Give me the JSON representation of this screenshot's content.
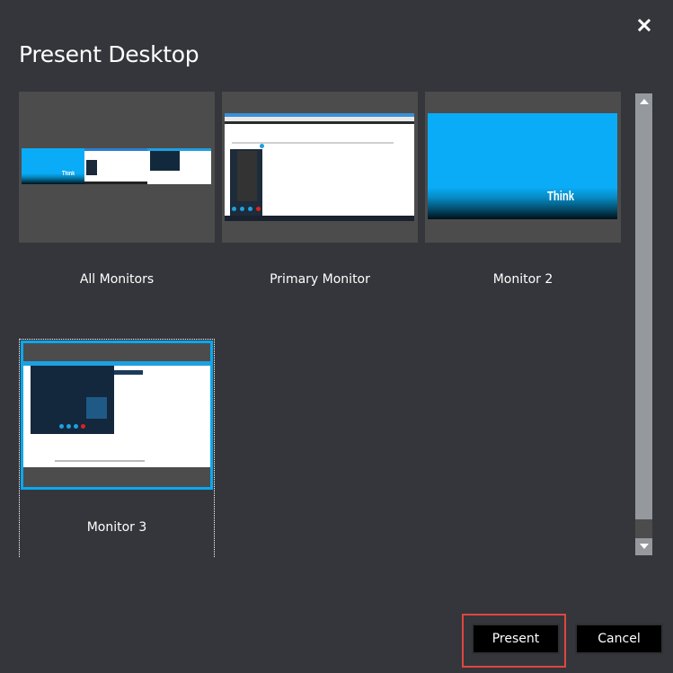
{
  "dialog": {
    "title": "Present Desktop",
    "close_icon": "close-icon"
  },
  "monitors": [
    {
      "label": "All Monitors",
      "selected": false
    },
    {
      "label": "Primary Monitor",
      "selected": false
    },
    {
      "label": "Monitor 2",
      "selected": false,
      "wallpaper_text": "Think"
    },
    {
      "label": "Monitor 3",
      "selected": true
    }
  ],
  "scrollbar": {
    "up_icon": "scroll-up-arrow-icon",
    "down_icon": "scroll-down-arrow-icon"
  },
  "buttons": {
    "present": "Present",
    "cancel": "Cancel"
  },
  "colors": {
    "background": "#35363b",
    "thumbnail_bg": "#4c4c4c",
    "selection": "#0aa8f0",
    "highlight": "#e0463f",
    "button_bg": "#000000"
  }
}
